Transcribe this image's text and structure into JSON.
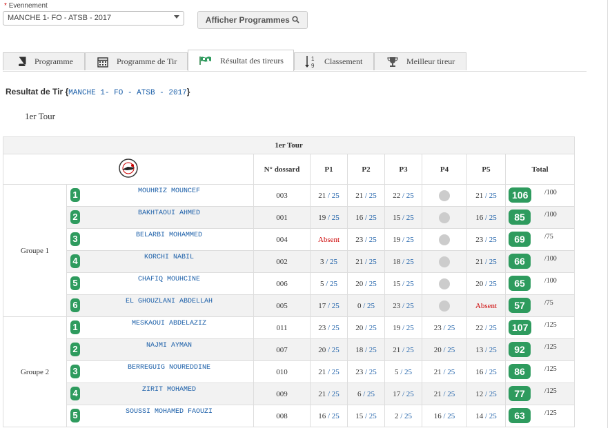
{
  "event": {
    "label": "Evennement",
    "required_mark": "*",
    "selected": "MANCHE 1- FO - ATSB - 2017",
    "show_button": "Afficher Programmes"
  },
  "tabs": [
    {
      "label": "Programme",
      "icon": "book-icon"
    },
    {
      "label": "Programme de Tir",
      "icon": "calendar-icon"
    },
    {
      "label": "Résultat des tireurs",
      "icon": "flag-icon",
      "active": true
    },
    {
      "label": "Classement",
      "icon": "sort-numeric-icon"
    },
    {
      "label": "Meilleur tireur",
      "icon": "trophy-icon"
    }
  ],
  "result": {
    "title": "Resultat de Tir {",
    "event_code": "MANCHE 1- FO - ATSB - 2017",
    "title_end": "}",
    "tour_label": "1er Tour"
  },
  "table": {
    "caption": "1er Tour",
    "headers": {
      "dossard": "N° dossard",
      "p1": "P1",
      "p2": "P2",
      "p3": "P3",
      "p4": "P4",
      "p5": "P5",
      "total": "Total"
    },
    "score_max": "25",
    "groups": [
      {
        "name": "Groupe 1",
        "rows": [
          {
            "rank": "1",
            "name": "MOUHRIZ MOUNCEF",
            "dossard": "003",
            "p": [
              "21",
              "21",
              "22",
              null,
              "21"
            ],
            "total": "106",
            "max": "/100"
          },
          {
            "rank": "2",
            "name": "BAKHTAOUI AHMED",
            "dossard": "001",
            "p": [
              "19",
              "16",
              "15",
              null,
              "16"
            ],
            "total": "85",
            "max": "/100"
          },
          {
            "rank": "3",
            "name": "BELARBI MOHAMMED",
            "dossard": "004",
            "p": [
              "Absent",
              "23",
              "19",
              null,
              "23"
            ],
            "total": "69",
            "max": "/75"
          },
          {
            "rank": "4",
            "name": "KORCHI NABIL",
            "dossard": "002",
            "p": [
              "3",
              "21",
              "18",
              null,
              "21"
            ],
            "total": "66",
            "max": "/100"
          },
          {
            "rank": "5",
            "name": "CHAFIQ MOUHCINE",
            "dossard": "006",
            "p": [
              "5",
              "20",
              "15",
              null,
              "20"
            ],
            "total": "65",
            "max": "/100"
          },
          {
            "rank": "6",
            "name": "EL GHOUZLANI ABDELLAH",
            "dossard": "005",
            "p": [
              "17",
              "0",
              "23",
              null,
              "Absent"
            ],
            "total": "57",
            "max": "/75"
          }
        ]
      },
      {
        "name": "Groupe 2",
        "rows": [
          {
            "rank": "1",
            "name": "MESKAOUI ABDELAZIZ",
            "dossard": "011",
            "p": [
              "23",
              "20",
              "19",
              "23",
              "22"
            ],
            "total": "107",
            "max": "/125"
          },
          {
            "rank": "2",
            "name": "NAJMI AYMAN",
            "dossard": "007",
            "p": [
              "20",
              "18",
              "21",
              "20",
              "13"
            ],
            "total": "92",
            "max": "/125"
          },
          {
            "rank": "3",
            "name": "BERREGUIG NOUREDDINE",
            "dossard": "010",
            "p": [
              "21",
              "23",
              "5",
              "21",
              "16"
            ],
            "total": "86",
            "max": "/125"
          },
          {
            "rank": "4",
            "name": "ZIRIT MOHAMED",
            "dossard": "009",
            "p": [
              "21",
              "6",
              "17",
              "21",
              "12"
            ],
            "total": "77",
            "max": "/125"
          },
          {
            "rank": "5",
            "name": "SOUSSI MOHAMED FAOUZI",
            "dossard": "008",
            "p": [
              "16",
              "15",
              "2",
              "16",
              "14"
            ],
            "total": "63",
            "max": "/125"
          }
        ]
      }
    ]
  },
  "colors": {
    "accent_green": "#2e9b5e",
    "link_blue": "#1a5ea8",
    "absent_red": "#c00000"
  }
}
